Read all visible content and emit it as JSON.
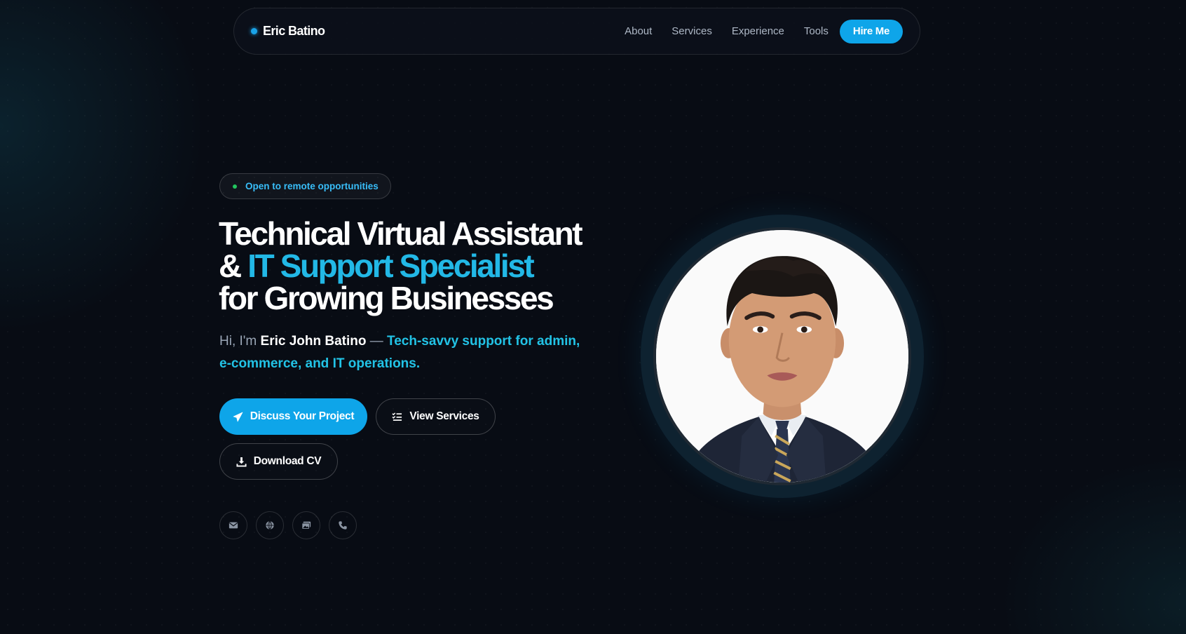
{
  "nav": {
    "brand": "Eric Batino",
    "links": [
      "About",
      "Services",
      "Experience",
      "Tools"
    ],
    "cta": "Hire Me"
  },
  "hero": {
    "badge": "Open to remote opportunities",
    "headline": {
      "line1": "Technical Virtual Assistant",
      "line2_prefix": "& ",
      "line2_accent": "IT Support Specialist",
      "line3": "for Growing Businesses"
    },
    "intro": {
      "greeting": "Hi, I'm ",
      "name": "Eric John Batino",
      "dash": " — ",
      "tagline": "Tech-savvy support for admin, e-commerce, and IT operations."
    },
    "buttons": {
      "primary": "Discuss Your Project",
      "services": "View Services",
      "cv": "Download CV"
    },
    "socials": [
      "mail-icon",
      "globe-icon",
      "gallery-icon",
      "phone-icon"
    ]
  },
  "colors": {
    "accent": "#0ea5e9",
    "accent_text": "#22b8e6",
    "background": "#080c14",
    "status_dot": "#22c55e"
  }
}
